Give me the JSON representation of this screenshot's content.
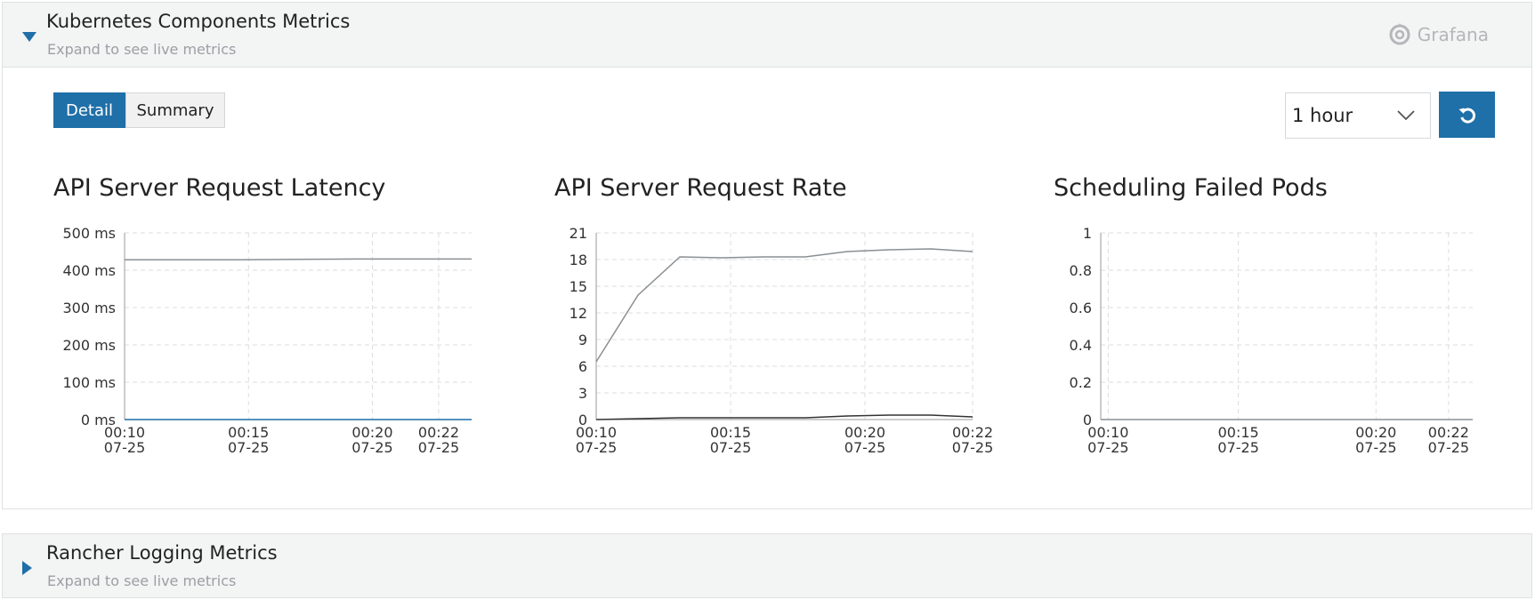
{
  "panels": [
    {
      "title": "Kubernetes Components Metrics",
      "subtitle": "Expand to see live metrics",
      "brand": "Grafana"
    },
    {
      "title": "Rancher Logging Metrics",
      "subtitle": "Expand to see live metrics"
    }
  ],
  "toolbar": {
    "view_modes": [
      "Detail",
      "Summary"
    ],
    "active_view": "Detail",
    "time_range": "1 hour",
    "icons": {
      "refresh": "refresh-icon",
      "dropdown": "chevron-down-icon",
      "brand": "grafana-logo-icon"
    }
  },
  "colors": {
    "accent": "#1f6fa8",
    "line": "#8a8f93",
    "line_dark": "#333333",
    "grid": "#dddddd"
  },
  "chart_data": [
    {
      "type": "line",
      "title": "API Server Request Latency",
      "x": [
        "00:10\n07-25",
        "00:15\n07-25",
        "00:20\n07-25",
        "00:22\n07-25"
      ],
      "x_ticks": [
        {
          "time": "00:10",
          "date": "07-25"
        },
        {
          "time": "00:15",
          "date": "07-25"
        },
        {
          "time": "00:20",
          "date": "07-25"
        },
        {
          "time": "00:22",
          "date": "07-25"
        }
      ],
      "y_ticks": [
        "500 ms",
        "400 ms",
        "300 ms",
        "200 ms",
        "100 ms",
        "0 ms"
      ],
      "ylim": [
        0,
        500
      ],
      "grid": true,
      "series": [
        {
          "values": [
            428,
            428,
            428,
            429,
            430,
            430,
            430
          ]
        },
        {
          "values": [
            0,
            0,
            0,
            0,
            0,
            0,
            0
          ]
        }
      ]
    },
    {
      "type": "line",
      "title": "API Server Request Rate",
      "x_ticks": [
        {
          "time": "00:10",
          "date": "07-25"
        },
        {
          "time": "00:15",
          "date": "07-25"
        },
        {
          "time": "00:20",
          "date": "07-25"
        },
        {
          "time": "00:22",
          "date": "07-25"
        }
      ],
      "y_ticks": [
        "21",
        "18",
        "15",
        "12",
        "9",
        "6",
        "3",
        "0"
      ],
      "ylim": [
        0,
        21
      ],
      "grid": true,
      "series": [
        {
          "values": [
            6.5,
            14,
            18.3,
            18.2,
            18.3,
            18.3,
            18.9,
            19.1,
            19.2,
            18.9
          ]
        },
        {
          "values": [
            0,
            0.1,
            0.2,
            0.2,
            0.2,
            0.2,
            0.4,
            0.5,
            0.5,
            0.3
          ]
        }
      ]
    },
    {
      "type": "line",
      "title": "Scheduling Failed Pods",
      "x_ticks": [
        {
          "time": "00:10",
          "date": "07-25"
        },
        {
          "time": "00:15",
          "date": "07-25"
        },
        {
          "time": "00:20",
          "date": "07-25"
        },
        {
          "time": "00:22",
          "date": "07-25"
        }
      ],
      "y_ticks": [
        "1",
        "0.8",
        "0.6",
        "0.4",
        "0.2",
        "0"
      ],
      "ylim": [
        0,
        1
      ],
      "grid": true,
      "series": [
        {
          "values": [
            0,
            0,
            0,
            0,
            0,
            0
          ]
        }
      ]
    }
  ]
}
